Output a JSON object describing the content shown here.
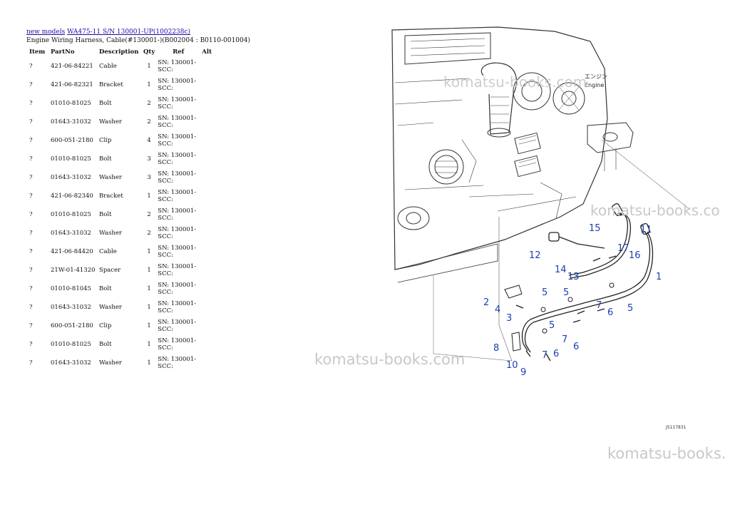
{
  "breadcrumb": {
    "link1": "new models",
    "link2": "WA475-11 S/N 130001-UP(1002238c)"
  },
  "subtitle": "Engine Wiring Harness, Cable(#130001-)(B002004 : B0110-001004)",
  "table": {
    "headers": [
      "Item",
      "PartNo",
      "Description",
      "Qty",
      "Ref",
      "Alt"
    ],
    "rows": [
      {
        "item": "?",
        "part": "421-06-84221",
        "desc": "Cable",
        "qty": "1",
        "ref": "SN: 130001-SCC:"
      },
      {
        "item": "?",
        "part": "421-06-82321",
        "desc": "Bracket",
        "qty": "1",
        "ref": "SN: 130001-SCC:"
      },
      {
        "item": "?",
        "part": "01010-81025",
        "desc": "Bolt",
        "qty": "2",
        "ref": "SN: 130001-SCC:"
      },
      {
        "item": "?",
        "part": "01643-31032",
        "desc": "Washer",
        "qty": "2",
        "ref": "SN: 130001-SCC:"
      },
      {
        "item": "?",
        "part": "600-051-2180",
        "desc": "Clip",
        "qty": "4",
        "ref": "SN: 130001-SCC:"
      },
      {
        "item": "?",
        "part": "01010-81025",
        "desc": "Bolt",
        "qty": "3",
        "ref": "SN: 130001-SCC:"
      },
      {
        "item": "?",
        "part": "01643-31032",
        "desc": "Washer",
        "qty": "3",
        "ref": "SN: 130001-SCC:"
      },
      {
        "item": "?",
        "part": "421-06-82340",
        "desc": "Bracket",
        "qty": "1",
        "ref": "SN: 130001-SCC:"
      },
      {
        "item": "?",
        "part": "01010-81025",
        "desc": "Bolt",
        "qty": "2",
        "ref": "SN: 130001-SCC:"
      },
      {
        "item": "?",
        "part": "01643-31032",
        "desc": "Washer",
        "qty": "2",
        "ref": "SN: 130001-SCC:"
      },
      {
        "item": "?",
        "part": "421-06-84420",
        "desc": "Cable",
        "qty": "1",
        "ref": "SN: 130001-SCC:"
      },
      {
        "item": "?",
        "part": "21W-01-41320",
        "desc": "Spacer",
        "qty": "1",
        "ref": "SN: 130001-SCC:"
      },
      {
        "item": "?",
        "part": "01010-81045",
        "desc": "Bolt",
        "qty": "1",
        "ref": "SN: 130001-SCC:"
      },
      {
        "item": "?",
        "part": "01643-31032",
        "desc": "Washer",
        "qty": "1",
        "ref": "SN: 130001-SCC:"
      },
      {
        "item": "?",
        "part": "600-051-2180",
        "desc": "Clip",
        "qty": "1",
        "ref": "SN: 130001-SCC:"
      },
      {
        "item": "?",
        "part": "01010-81025",
        "desc": "Bolt",
        "qty": "1",
        "ref": "SN: 130001-SCC:"
      },
      {
        "item": "?",
        "part": "01643-31032",
        "desc": "Washer",
        "qty": "1",
        "ref": "SN: 130001-SCC:"
      }
    ]
  },
  "watermark": "komatsu-books.com",
  "watermark_partial": "komatsu-books.",
  "watermark_partial_edge": "komatsu-books.co",
  "diagram": {
    "engine_label_jp": "エンジン",
    "engine_label_en": "Engine",
    "figure_code": "JS117831",
    "callouts": [
      "1",
      "2",
      "3",
      "4",
      "5",
      "5",
      "5",
      "5",
      "6",
      "6",
      "6",
      "7",
      "7",
      "7",
      "8",
      "9",
      "10",
      "11",
      "12",
      "13",
      "14",
      "15",
      "16",
      "17"
    ]
  },
  "colors": {
    "link": "#1a0dab",
    "callout": "#1a3fb0",
    "watermark": "#c8c8c8"
  }
}
